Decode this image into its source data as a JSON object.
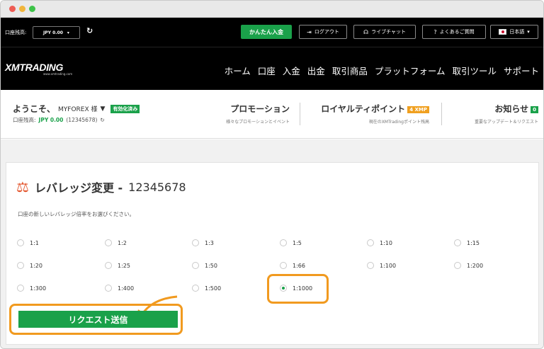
{
  "topbar": {
    "balance_label": "口座残高:",
    "currency_value": "JPY 0.00",
    "buttons": [
      {
        "label": "かんたん入金",
        "icon": ""
      },
      {
        "label": "ログアウト",
        "icon": "logout-icon"
      },
      {
        "label": "ライブチャット",
        "icon": "headset-icon"
      },
      {
        "label": "よくあるご質問",
        "icon": "question-icon"
      },
      {
        "label": "日本語",
        "icon": "japan-flag-icon"
      }
    ]
  },
  "nav": {
    "logo": "XMTRADING",
    "logo_sub": "www.xmtrading.com",
    "items": [
      "ホーム",
      "口座",
      "入金",
      "出金",
      "取引商品",
      "プラットフォーム",
      "取引ツール",
      "サポート"
    ]
  },
  "welcome": {
    "greeting": "ようこそ、",
    "name": "MYFOREX 様",
    "verified": "有効化済み",
    "balance_label": "口座残高:",
    "balance_value": "JPY 0.00",
    "account_number": "(12345678)"
  },
  "promo": {
    "title": "プロモーション",
    "subtitle": "様々なプロモーションとイベント"
  },
  "loyalty": {
    "title": "ロイヤルティポイント",
    "badge": "4 XMP",
    "subtitle": "現在のXMTradingポイント残高"
  },
  "notice": {
    "title": "お知らせ",
    "badge": "0",
    "subtitle": "重要なアップデート＆リクエスト"
  },
  "leverage": {
    "title": "レバレッジ変更 -",
    "account": "12345678",
    "instruction": "口座の新しいレバレッジ倍率をお選びください。",
    "options": [
      "1:1",
      "1:2",
      "1:3",
      "1:5",
      "1:10",
      "1:15",
      "1:20",
      "1:25",
      "1:50",
      "1:66",
      "1:100",
      "1:200",
      "1:300",
      "1:400",
      "1:500",
      "1:1000"
    ],
    "selected": "1:1000",
    "submit_label": "リクエスト送信"
  },
  "colors": {
    "green": "#1aa14a",
    "orange": "#f19a1f",
    "icon_red": "#e3542b"
  }
}
